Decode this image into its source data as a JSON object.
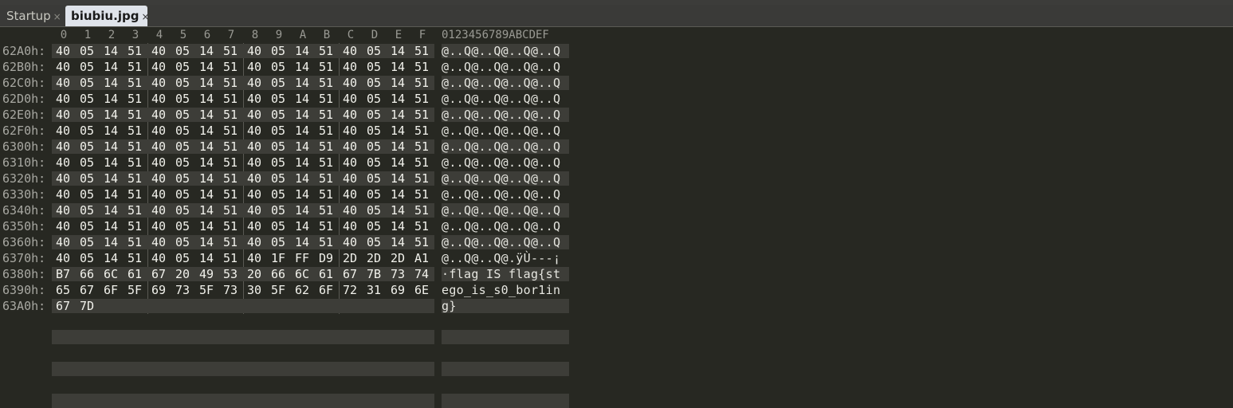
{
  "tabs": [
    {
      "label": "Startup",
      "close": "×",
      "active": false
    },
    {
      "label": "biubiu.jpg",
      "close": "×",
      "active": true
    }
  ],
  "header": {
    "hex_columns": [
      "0",
      "1",
      "2",
      "3",
      "4",
      "5",
      "6",
      "7",
      "8",
      "9",
      "A",
      "B",
      "C",
      "D",
      "E",
      "F"
    ],
    "ascii_header": "0123456789ABCDEF"
  },
  "rows": [
    {
      "addr": "62A0h:",
      "bytes": [
        "40",
        "05",
        "14",
        "51",
        "40",
        "05",
        "14",
        "51",
        "40",
        "05",
        "14",
        "51",
        "40",
        "05",
        "14",
        "51"
      ],
      "ascii": "@..Q@..Q@..Q@..Q"
    },
    {
      "addr": "62B0h:",
      "bytes": [
        "40",
        "05",
        "14",
        "51",
        "40",
        "05",
        "14",
        "51",
        "40",
        "05",
        "14",
        "51",
        "40",
        "05",
        "14",
        "51"
      ],
      "ascii": "@..Q@..Q@..Q@..Q"
    },
    {
      "addr": "62C0h:",
      "bytes": [
        "40",
        "05",
        "14",
        "51",
        "40",
        "05",
        "14",
        "51",
        "40",
        "05",
        "14",
        "51",
        "40",
        "05",
        "14",
        "51"
      ],
      "ascii": "@..Q@..Q@..Q@..Q"
    },
    {
      "addr": "62D0h:",
      "bytes": [
        "40",
        "05",
        "14",
        "51",
        "40",
        "05",
        "14",
        "51",
        "40",
        "05",
        "14",
        "51",
        "40",
        "05",
        "14",
        "51"
      ],
      "ascii": "@..Q@..Q@..Q@..Q"
    },
    {
      "addr": "62E0h:",
      "bytes": [
        "40",
        "05",
        "14",
        "51",
        "40",
        "05",
        "14",
        "51",
        "40",
        "05",
        "14",
        "51",
        "40",
        "05",
        "14",
        "51"
      ],
      "ascii": "@..Q@..Q@..Q@..Q"
    },
    {
      "addr": "62F0h:",
      "bytes": [
        "40",
        "05",
        "14",
        "51",
        "40",
        "05",
        "14",
        "51",
        "40",
        "05",
        "14",
        "51",
        "40",
        "05",
        "14",
        "51"
      ],
      "ascii": "@..Q@..Q@..Q@..Q"
    },
    {
      "addr": "6300h:",
      "bytes": [
        "40",
        "05",
        "14",
        "51",
        "40",
        "05",
        "14",
        "51",
        "40",
        "05",
        "14",
        "51",
        "40",
        "05",
        "14",
        "51"
      ],
      "ascii": "@..Q@..Q@..Q@..Q"
    },
    {
      "addr": "6310h:",
      "bytes": [
        "40",
        "05",
        "14",
        "51",
        "40",
        "05",
        "14",
        "51",
        "40",
        "05",
        "14",
        "51",
        "40",
        "05",
        "14",
        "51"
      ],
      "ascii": "@..Q@..Q@..Q@..Q"
    },
    {
      "addr": "6320h:",
      "bytes": [
        "40",
        "05",
        "14",
        "51",
        "40",
        "05",
        "14",
        "51",
        "40",
        "05",
        "14",
        "51",
        "40",
        "05",
        "14",
        "51"
      ],
      "ascii": "@..Q@..Q@..Q@..Q"
    },
    {
      "addr": "6330h:",
      "bytes": [
        "40",
        "05",
        "14",
        "51",
        "40",
        "05",
        "14",
        "51",
        "40",
        "05",
        "14",
        "51",
        "40",
        "05",
        "14",
        "51"
      ],
      "ascii": "@..Q@..Q@..Q@..Q"
    },
    {
      "addr": "6340h:",
      "bytes": [
        "40",
        "05",
        "14",
        "51",
        "40",
        "05",
        "14",
        "51",
        "40",
        "05",
        "14",
        "51",
        "40",
        "05",
        "14",
        "51"
      ],
      "ascii": "@..Q@..Q@..Q@..Q"
    },
    {
      "addr": "6350h:",
      "bytes": [
        "40",
        "05",
        "14",
        "51",
        "40",
        "05",
        "14",
        "51",
        "40",
        "05",
        "14",
        "51",
        "40",
        "05",
        "14",
        "51"
      ],
      "ascii": "@..Q@..Q@..Q@..Q"
    },
    {
      "addr": "6360h:",
      "bytes": [
        "40",
        "05",
        "14",
        "51",
        "40",
        "05",
        "14",
        "51",
        "40",
        "05",
        "14",
        "51",
        "40",
        "05",
        "14",
        "51"
      ],
      "ascii": "@..Q@..Q@..Q@..Q"
    },
    {
      "addr": "6370h:",
      "bytes": [
        "40",
        "05",
        "14",
        "51",
        "40",
        "05",
        "14",
        "51",
        "40",
        "1F",
        "FF",
        "D9",
        "2D",
        "2D",
        "2D",
        "A1"
      ],
      "ascii": "@..Q@..Q@.ÿÙ---¡"
    },
    {
      "addr": "6380h:",
      "bytes": [
        "B7",
        "66",
        "6C",
        "61",
        "67",
        "20",
        "49",
        "53",
        "20",
        "66",
        "6C",
        "61",
        "67",
        "7B",
        "73",
        "74"
      ],
      "ascii": "·flag IS flag{st"
    },
    {
      "addr": "6390h:",
      "bytes": [
        "65",
        "67",
        "6F",
        "5F",
        "69",
        "73",
        "5F",
        "73",
        "30",
        "5F",
        "62",
        "6F",
        "72",
        "31",
        "69",
        "6E"
      ],
      "ascii": "ego_is_s0_bor1in"
    },
    {
      "addr": "63A0h:",
      "bytes": [
        "67",
        "7D"
      ],
      "ascii": "g}"
    }
  ]
}
